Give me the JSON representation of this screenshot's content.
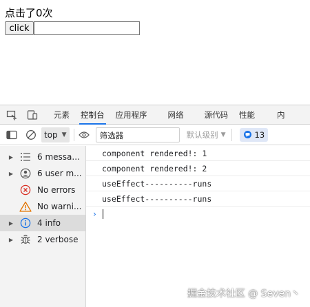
{
  "page": {
    "title": "点击了0次",
    "button_label": "click",
    "input_value": ""
  },
  "devtools": {
    "tabs": [
      {
        "label": "元素"
      },
      {
        "label": "控制台"
      },
      {
        "label": "应用程序"
      },
      {
        "label": "网络"
      },
      {
        "label": "源代码"
      },
      {
        "label": "性能"
      },
      {
        "label": "内"
      }
    ],
    "active_tab": "控制台",
    "toolbar": {
      "context": "top",
      "filter_placeholder": "筛选器",
      "levels": "默认级别",
      "issues_count": "13"
    },
    "sidebar": [
      {
        "label": "6 messa...",
        "icon": "list-icon"
      },
      {
        "label": "6 user m...",
        "icon": "user-icon"
      },
      {
        "label": "No errors",
        "icon": "error-icon"
      },
      {
        "label": "No warni...",
        "icon": "warning-icon"
      },
      {
        "label": "4 info",
        "icon": "info-icon"
      },
      {
        "label": "2 verbose",
        "icon": "bug-icon"
      }
    ],
    "logs": [
      "component rendered!: 1",
      "component rendered!: 2",
      "useEffect----------runs",
      "useEffect----------runs"
    ]
  },
  "watermark": "掘金技术社区 @ Seven丶",
  "colors": {
    "accent": "#1a73e8",
    "error": "#d93025",
    "warning": "#e37400"
  }
}
